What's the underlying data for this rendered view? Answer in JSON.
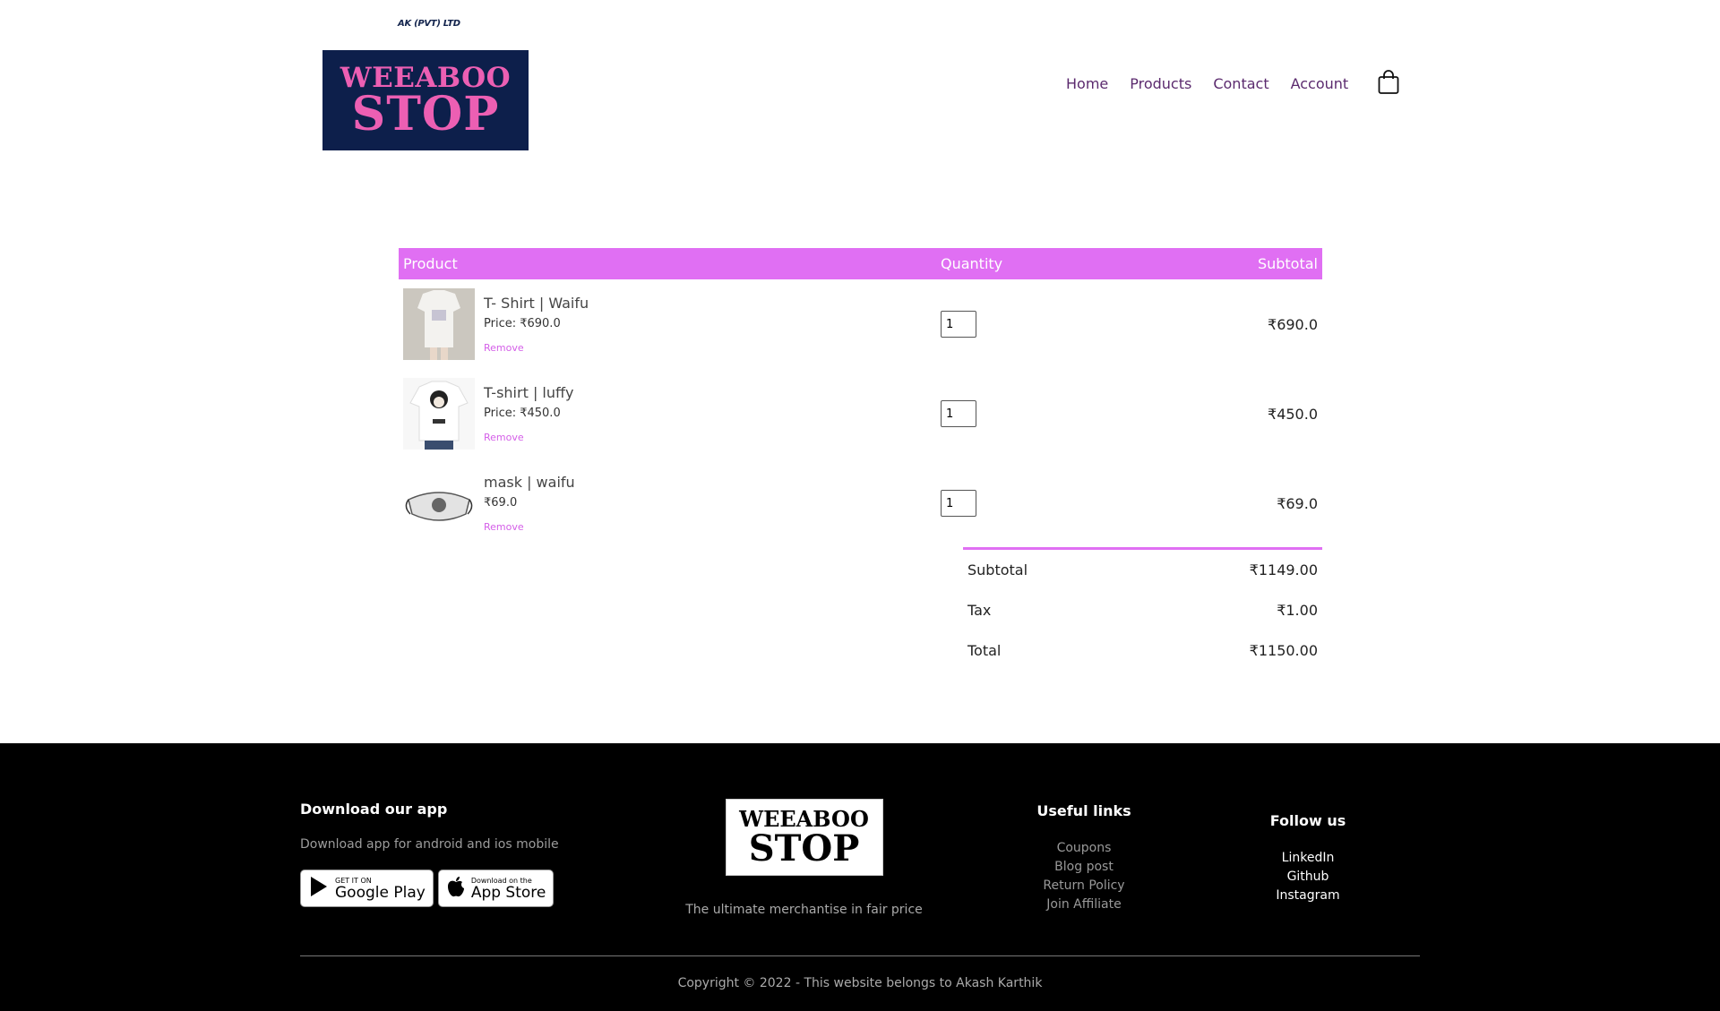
{
  "header": {
    "tagline": "AK (PVT) LTD",
    "logo_line1": "WEEABOO",
    "logo_line2": "STOP",
    "nav": [
      "Home",
      "Products",
      "Contact",
      "Account"
    ]
  },
  "cart": {
    "headers": {
      "product": "Product",
      "quantity": "Quantity",
      "subtotal": "Subtotal"
    },
    "items": [
      {
        "name": "T- Shirt | Waifu",
        "price": "Price: ₹690.0",
        "remove": "Remove",
        "qty": "1",
        "subtotal": "₹690.0"
      },
      {
        "name": "T-shirt | luffy",
        "price": "Price: ₹450.0",
        "remove": "Remove",
        "qty": "1",
        "subtotal": "₹450.0"
      },
      {
        "name": "mask | waifu",
        "price": "₹69.0",
        "remove": "Remove",
        "qty": "1",
        "subtotal": "₹69.0"
      }
    ],
    "totals": [
      {
        "label": "Subtotal",
        "value": "₹1149.00"
      },
      {
        "label": "Tax",
        "value": "₹1.00"
      },
      {
        "label": "Total",
        "value": "₹1150.00"
      }
    ]
  },
  "footer": {
    "app_title": "Download our app",
    "app_sub": "Download app for android and ios mobile",
    "google_small": "GET IT ON",
    "google_big": "Google Play",
    "apple_small": "Download on the",
    "apple_big": "App Store",
    "logo_line1": "WEEABOO",
    "logo_line2": "STOP",
    "tagline": "The ultimate merchantise in fair price",
    "useful_title": "Useful links",
    "useful_links": [
      "Coupons",
      "Blog post",
      "Return Policy",
      "Join Affiliate"
    ],
    "follow_title": "Follow us",
    "follow_links": [
      "LinkedIn",
      "Github",
      "Instagram"
    ],
    "copyright": "Copyright © 2022 - This website belongs to Akash Karthik"
  },
  "colors": {
    "accent": "#e06ff3",
    "logo_bg": "#0d1f4b",
    "logo_text": "#ec5fb3",
    "nav": "#5b2a6e"
  }
}
